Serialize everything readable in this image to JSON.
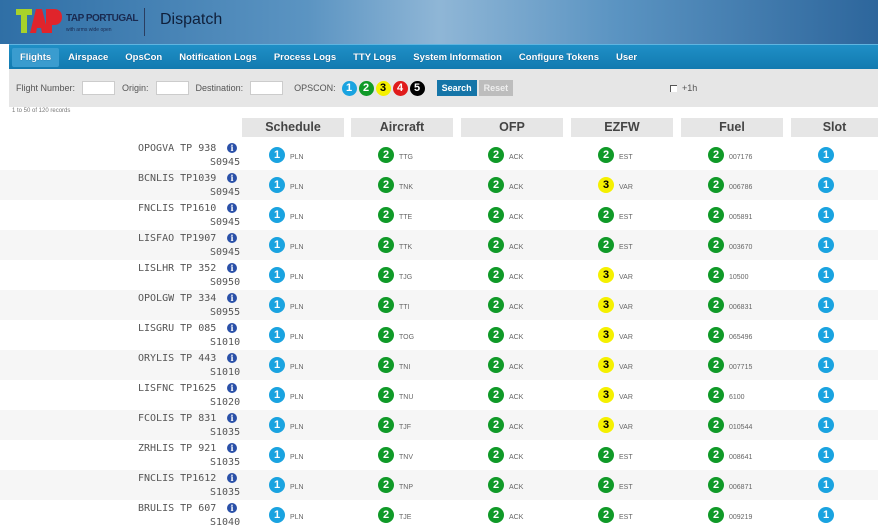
{
  "header": {
    "brand": "TAP PORTUGAL",
    "tagline": "with arms wide open",
    "logo_text": "TAP",
    "title": "Dispatch"
  },
  "nav": [
    {
      "label": "Flights",
      "active": true
    },
    {
      "label": "Airspace"
    },
    {
      "label": "OpsCon"
    },
    {
      "label": "Notification Logs"
    },
    {
      "label": "Process Logs"
    },
    {
      "label": "TTY Logs"
    },
    {
      "label": "System Information"
    },
    {
      "label": "Configure Tokens"
    },
    {
      "label": "User"
    }
  ],
  "filter": {
    "flight_number_label": "Flight Number:",
    "flight_number_value": "",
    "origin_label": "Origin:",
    "origin_value": "",
    "destination_label": "Destination:",
    "destination_value": "",
    "opscon_label": "OPSCON:",
    "opscon": [
      "1",
      "2",
      "3",
      "4",
      "5"
    ],
    "search": "Search",
    "reset": "Reset",
    "plus1h_label": "+1h",
    "plus1h_checked": false
  },
  "records": "1 to 50 of 120 records",
  "columns": [
    "Schedule",
    "Aircraft",
    "OFP",
    "EZFW",
    "Fuel",
    "Slot"
  ],
  "colors": {
    "1": "#1aa3e0",
    "2": "#109a28",
    "3": "#f5f000",
    "4": "#e01b1b",
    "5": "#000000"
  },
  "rows": [
    {
      "route": "OPOGVA",
      "flight": "TP 938",
      "sched": "S0945",
      "schedule": {
        "s": "1",
        "t": "PLN"
      },
      "aircraft": {
        "s": "2",
        "t": "TTG"
      },
      "ofp": {
        "s": "2",
        "t": "ACK"
      },
      "ezfw": {
        "s": "2",
        "t": "EST"
      },
      "fuel": {
        "s": "2",
        "t": "007176"
      },
      "slot": {
        "s": "1"
      }
    },
    {
      "route": "BCNLIS",
      "flight": "TP1039",
      "sched": "S0945",
      "schedule": {
        "s": "1",
        "t": "PLN"
      },
      "aircraft": {
        "s": "2",
        "t": "TNK"
      },
      "ofp": {
        "s": "2",
        "t": "ACK"
      },
      "ezfw": {
        "s": "3",
        "t": "VAR"
      },
      "fuel": {
        "s": "2",
        "t": "006786"
      },
      "slot": {
        "s": "1"
      }
    },
    {
      "route": "FNCLIS",
      "flight": "TP1610",
      "sched": "S0945",
      "schedule": {
        "s": "1",
        "t": "PLN"
      },
      "aircraft": {
        "s": "2",
        "t": "TTE"
      },
      "ofp": {
        "s": "2",
        "t": "ACK"
      },
      "ezfw": {
        "s": "2",
        "t": "EST"
      },
      "fuel": {
        "s": "2",
        "t": "005891"
      },
      "slot": {
        "s": "1"
      }
    },
    {
      "route": "LISFAO",
      "flight": "TP1907",
      "sched": "S0945",
      "schedule": {
        "s": "1",
        "t": "PLN"
      },
      "aircraft": {
        "s": "2",
        "t": "TTK"
      },
      "ofp": {
        "s": "2",
        "t": "ACK"
      },
      "ezfw": {
        "s": "2",
        "t": "EST"
      },
      "fuel": {
        "s": "2",
        "t": "003670"
      },
      "slot": {
        "s": "1"
      }
    },
    {
      "route": "LISLHR",
      "flight": "TP 352",
      "sched": "S0950",
      "schedule": {
        "s": "1",
        "t": "PLN"
      },
      "aircraft": {
        "s": "2",
        "t": "TJG"
      },
      "ofp": {
        "s": "2",
        "t": "ACK"
      },
      "ezfw": {
        "s": "3",
        "t": "VAR"
      },
      "fuel": {
        "s": "2",
        "t": "10500"
      },
      "slot": {
        "s": "1"
      }
    },
    {
      "route": "OPOLGW",
      "flight": "TP 334",
      "sched": "S0955",
      "schedule": {
        "s": "1",
        "t": "PLN"
      },
      "aircraft": {
        "s": "2",
        "t": "TTI"
      },
      "ofp": {
        "s": "2",
        "t": "ACK"
      },
      "ezfw": {
        "s": "3",
        "t": "VAR"
      },
      "fuel": {
        "s": "2",
        "t": "006831"
      },
      "slot": {
        "s": "1"
      }
    },
    {
      "route": "LISGRU",
      "flight": "TP 085",
      "sched": "S1010",
      "schedule": {
        "s": "1",
        "t": "PLN"
      },
      "aircraft": {
        "s": "2",
        "t": "TOG"
      },
      "ofp": {
        "s": "2",
        "t": "ACK"
      },
      "ezfw": {
        "s": "3",
        "t": "VAR"
      },
      "fuel": {
        "s": "2",
        "t": "065496"
      },
      "slot": {
        "s": "1"
      }
    },
    {
      "route": "ORYLIS",
      "flight": "TP 443",
      "sched": "S1010",
      "schedule": {
        "s": "1",
        "t": "PLN"
      },
      "aircraft": {
        "s": "2",
        "t": "TNI"
      },
      "ofp": {
        "s": "2",
        "t": "ACK"
      },
      "ezfw": {
        "s": "3",
        "t": "VAR"
      },
      "fuel": {
        "s": "2",
        "t": "007715"
      },
      "slot": {
        "s": "1"
      }
    },
    {
      "route": "LISFNC",
      "flight": "TP1625",
      "sched": "S1020",
      "schedule": {
        "s": "1",
        "t": "PLN"
      },
      "aircraft": {
        "s": "2",
        "t": "TNU"
      },
      "ofp": {
        "s": "2",
        "t": "ACK"
      },
      "ezfw": {
        "s": "3",
        "t": "VAR"
      },
      "fuel": {
        "s": "2",
        "t": "6100"
      },
      "slot": {
        "s": "1"
      }
    },
    {
      "route": "FCOLIS",
      "flight": "TP 831",
      "sched": "S1035",
      "schedule": {
        "s": "1",
        "t": "PLN"
      },
      "aircraft": {
        "s": "2",
        "t": "TJF"
      },
      "ofp": {
        "s": "2",
        "t": "ACK"
      },
      "ezfw": {
        "s": "3",
        "t": "VAR"
      },
      "fuel": {
        "s": "2",
        "t": "010544"
      },
      "slot": {
        "s": "1"
      }
    },
    {
      "route": "ZRHLIS",
      "flight": "TP 921",
      "sched": "S1035",
      "schedule": {
        "s": "1",
        "t": "PLN"
      },
      "aircraft": {
        "s": "2",
        "t": "TNV"
      },
      "ofp": {
        "s": "2",
        "t": "ACK"
      },
      "ezfw": {
        "s": "2",
        "t": "EST"
      },
      "fuel": {
        "s": "2",
        "t": "008641"
      },
      "slot": {
        "s": "1"
      }
    },
    {
      "route": "FNCLIS",
      "flight": "TP1612",
      "sched": "S1035",
      "schedule": {
        "s": "1",
        "t": "PLN"
      },
      "aircraft": {
        "s": "2",
        "t": "TNP"
      },
      "ofp": {
        "s": "2",
        "t": "ACK"
      },
      "ezfw": {
        "s": "2",
        "t": "EST"
      },
      "fuel": {
        "s": "2",
        "t": "006871"
      },
      "slot": {
        "s": "1"
      }
    },
    {
      "route": "BRULIS",
      "flight": "TP 607",
      "sched": "S1040",
      "schedule": {
        "s": "1",
        "t": "PLN"
      },
      "aircraft": {
        "s": "2",
        "t": "TJE"
      },
      "ofp": {
        "s": "2",
        "t": "ACK"
      },
      "ezfw": {
        "s": "2",
        "t": "EST"
      },
      "fuel": {
        "s": "2",
        "t": "009219"
      },
      "slot": {
        "s": "1"
      }
    }
  ]
}
